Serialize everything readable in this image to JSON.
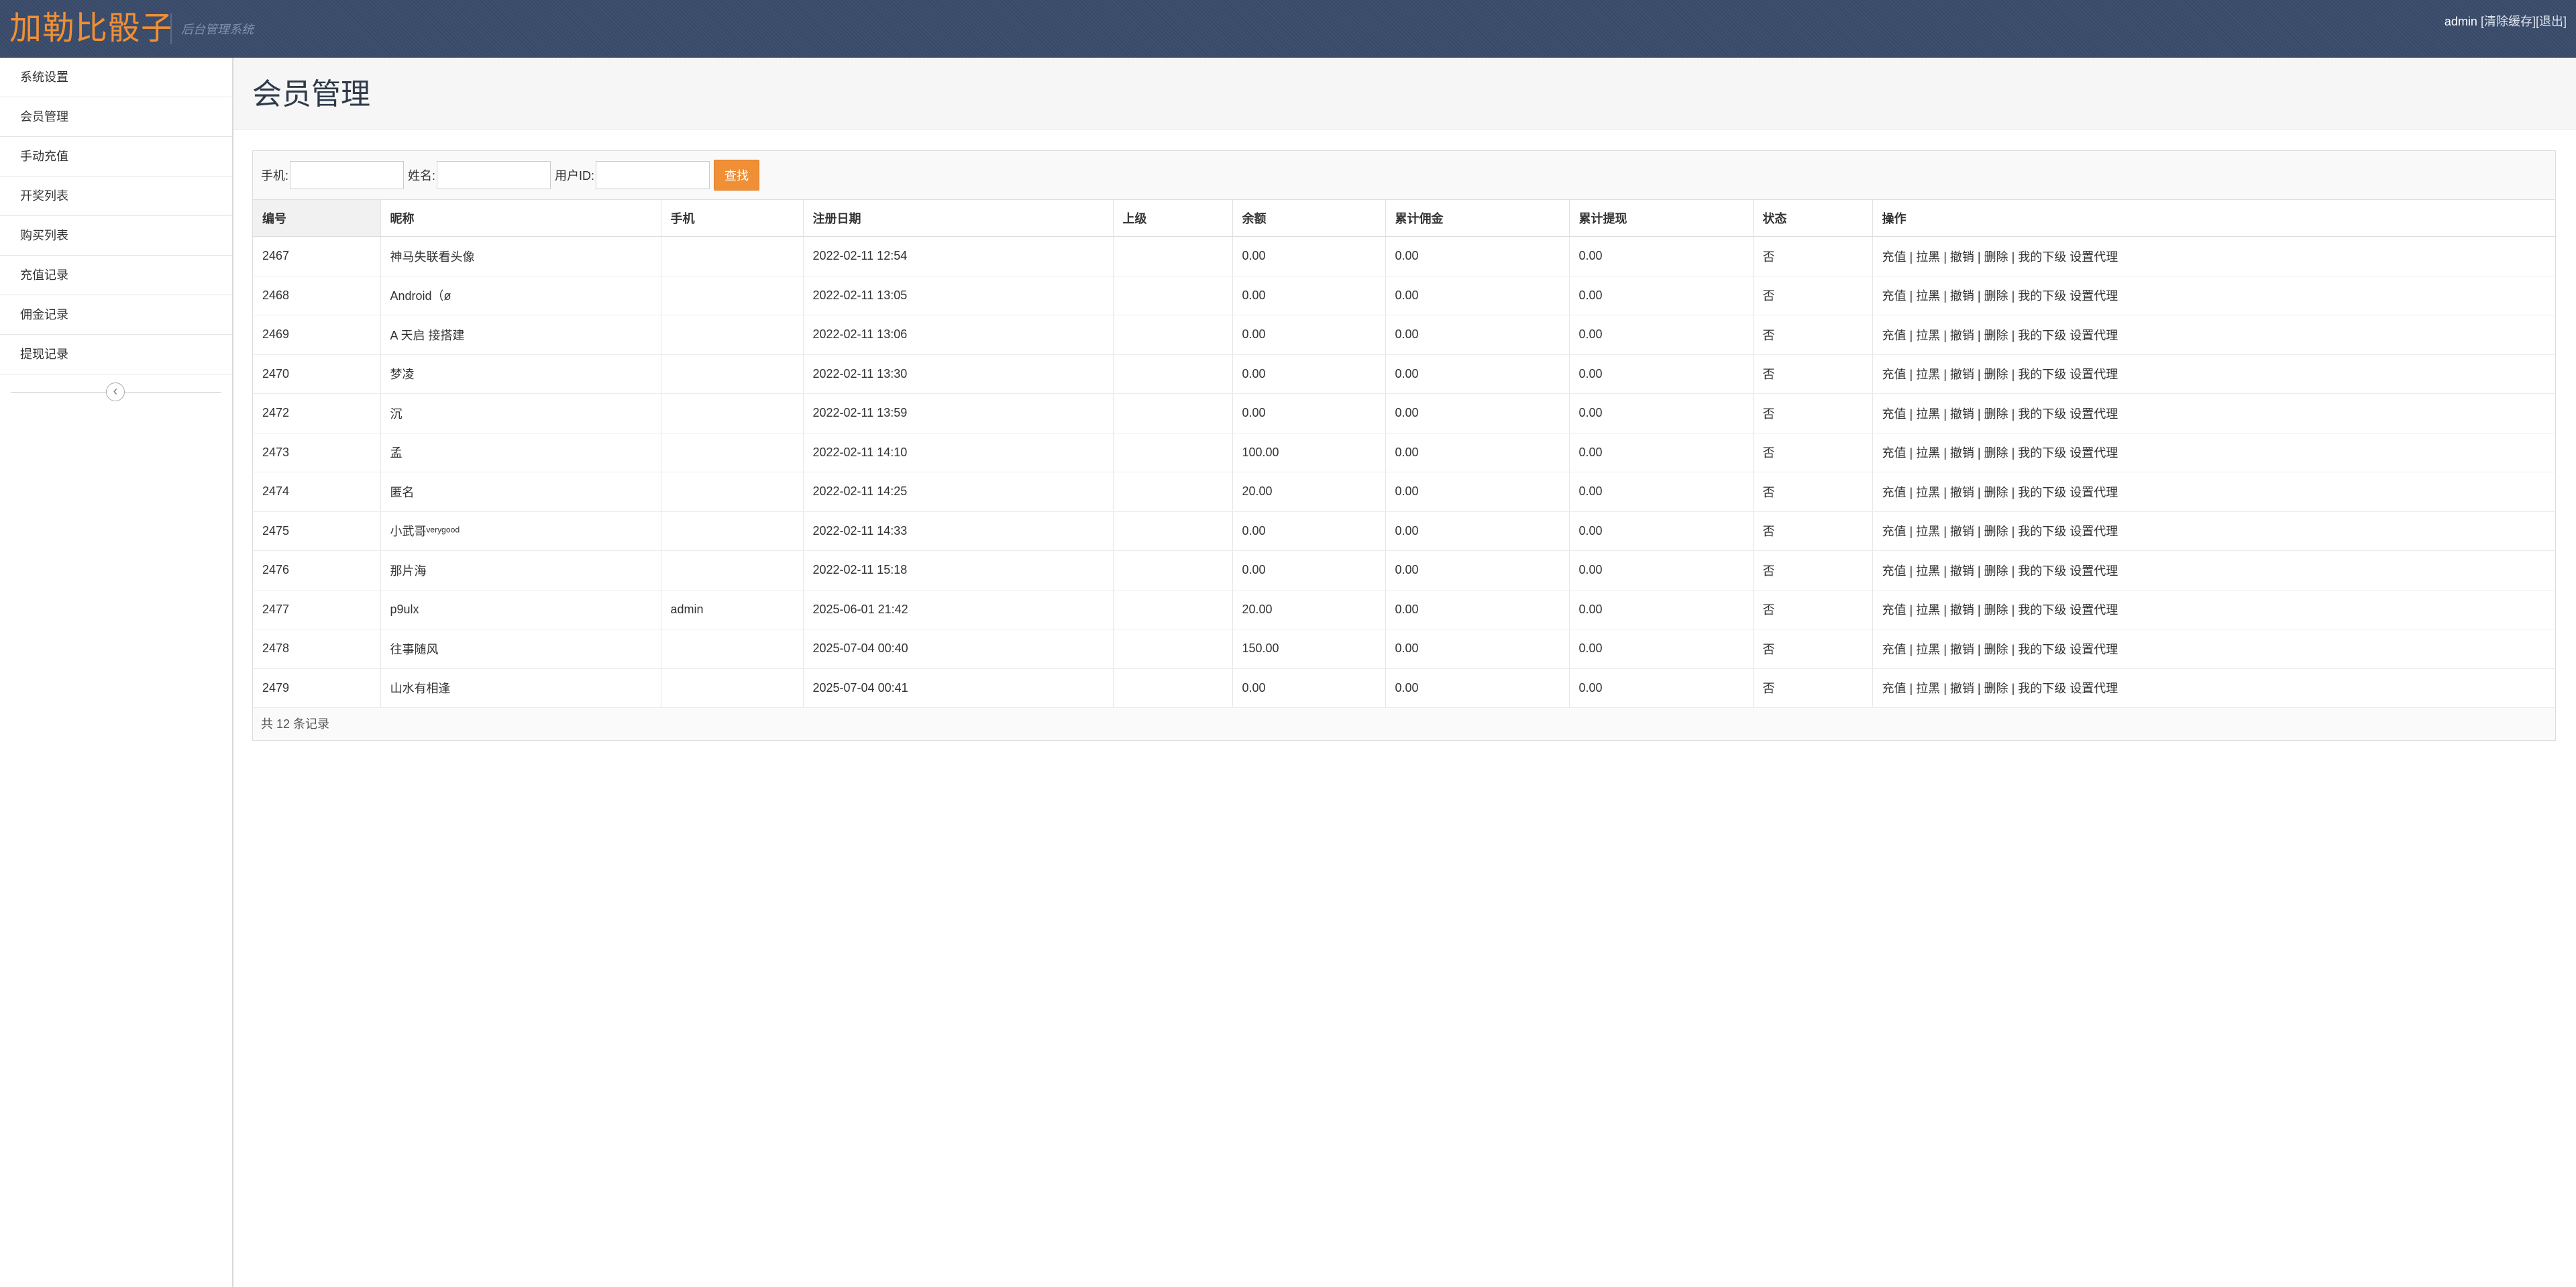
{
  "header": {
    "brand": "加勒比骰子",
    "subtitle": "后台管理系统",
    "user": "admin",
    "clear_cache": "[清除缓存]",
    "logout": "[退出]"
  },
  "sidebar": {
    "items": [
      {
        "label": "系统设置"
      },
      {
        "label": "会员管理"
      },
      {
        "label": "手动充值"
      },
      {
        "label": "开奖列表"
      },
      {
        "label": "购买列表"
      },
      {
        "label": "充值记录"
      },
      {
        "label": "佣金记录"
      },
      {
        "label": "提现记录"
      }
    ],
    "collapse_icon": "chevron-left-icon"
  },
  "page": {
    "title": "会员管理"
  },
  "filter": {
    "phone_label": "手机:",
    "phone_value": "",
    "name_label": "姓名:",
    "name_value": "",
    "userid_label": "用户ID:",
    "userid_value": "",
    "search_label": "查找"
  },
  "table": {
    "columns": [
      "编号",
      "昵称",
      "手机",
      "注册日期",
      "上级",
      "余额",
      "累计佣金",
      "累计提现",
      "状态",
      "操作"
    ],
    "ops": [
      "充值",
      "拉黑",
      "撤销",
      "删除",
      "我的下级",
      "设置代理"
    ],
    "rows": [
      {
        "id": "2467",
        "nick": "神马失联看头像",
        "phone": "",
        "date": "2022-02-11 12:54",
        "parent": "",
        "balance": "0.00",
        "commission": "0.00",
        "withdraw": "0.00",
        "status": "否"
      },
      {
        "id": "2468",
        "nick": "Android（ø",
        "phone": "",
        "date": "2022-02-11 13:05",
        "parent": "",
        "balance": "0.00",
        "commission": "0.00",
        "withdraw": "0.00",
        "status": "否"
      },
      {
        "id": "2469",
        "nick": "A 天启 接搭建",
        "phone": "",
        "date": "2022-02-11 13:06",
        "parent": "",
        "balance": "0.00",
        "commission": "0.00",
        "withdraw": "0.00",
        "status": "否"
      },
      {
        "id": "2470",
        "nick": "梦凌",
        "phone": "",
        "date": "2022-02-11 13:30",
        "parent": "",
        "balance": "0.00",
        "commission": "0.00",
        "withdraw": "0.00",
        "status": "否"
      },
      {
        "id": "2472",
        "nick": "沉",
        "phone": "",
        "date": "2022-02-11 13:59",
        "parent": "",
        "balance": "0.00",
        "commission": "0.00",
        "withdraw": "0.00",
        "status": "否"
      },
      {
        "id": "2473",
        "nick": "孟",
        "phone": "",
        "date": "2022-02-11 14:10",
        "parent": "",
        "balance": "100.00",
        "commission": "0.00",
        "withdraw": "0.00",
        "status": "否"
      },
      {
        "id": "2474",
        "nick": "匿名",
        "phone": "",
        "date": "2022-02-11 14:25",
        "parent": "",
        "balance": "20.00",
        "commission": "0.00",
        "withdraw": "0.00",
        "status": "否"
      },
      {
        "id": "2475",
        "nick": "小武哥ᵛᵉʳʸᵍᵒᵒᵈ",
        "phone": "",
        "date": "2022-02-11 14:33",
        "parent": "",
        "balance": "0.00",
        "commission": "0.00",
        "withdraw": "0.00",
        "status": "否"
      },
      {
        "id": "2476",
        "nick": "那片海",
        "phone": "",
        "date": "2022-02-11 15:18",
        "parent": "",
        "balance": "0.00",
        "commission": "0.00",
        "withdraw": "0.00",
        "status": "否"
      },
      {
        "id": "2477",
        "nick": "p9ulx",
        "phone": "admin",
        "date": "2025-06-01 21:42",
        "parent": "",
        "balance": "20.00",
        "commission": "0.00",
        "withdraw": "0.00",
        "status": "否"
      },
      {
        "id": "2478",
        "nick": "往事随风",
        "phone": "",
        "date": "2025-07-04 00:40",
        "parent": "",
        "balance": "150.00",
        "commission": "0.00",
        "withdraw": "0.00",
        "status": "否"
      },
      {
        "id": "2479",
        "nick": "山水有相逢",
        "phone": "",
        "date": "2025-07-04 00:41",
        "parent": "",
        "balance": "0.00",
        "commission": "0.00",
        "withdraw": "0.00",
        "status": "否"
      }
    ],
    "footer": "共 12 条记录"
  },
  "colors": {
    "brand": "#f08f36",
    "header_bg": "#3a4b6a",
    "search_button": "#f08f36"
  }
}
